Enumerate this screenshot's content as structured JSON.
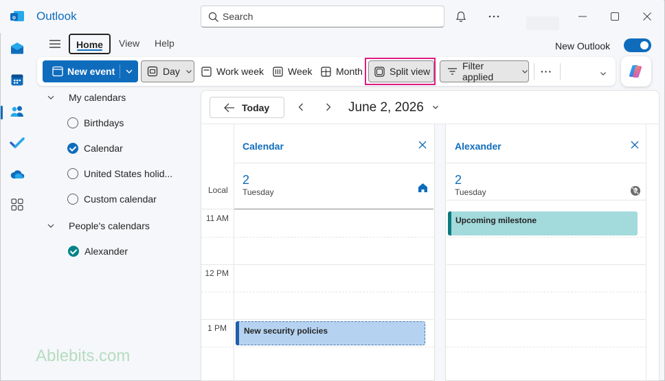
{
  "titlebar": {
    "app_name": "Outlook",
    "search_placeholder": "Search"
  },
  "menu": {
    "tabs": [
      "Home",
      "View",
      "Help"
    ],
    "new_outlook_label": "New Outlook",
    "new_outlook_enabled": true
  },
  "ribbon": {
    "new_event": "New event",
    "day": "Day",
    "work_week": "Work week",
    "week": "Week",
    "month": "Month",
    "split_view": "Split view",
    "filter": "Filter applied",
    "more": "···"
  },
  "folders": {
    "my_calendars": {
      "label": "My calendars",
      "items": [
        {
          "label": "Birthdays",
          "checked": false
        },
        {
          "label": "Calendar",
          "checked": true
        },
        {
          "label": "United States holid...",
          "checked": false
        },
        {
          "label": "Custom calendar",
          "checked": false
        }
      ]
    },
    "people_calendars": {
      "label": "People's calendars",
      "items": [
        {
          "label": "Alexander",
          "checked": true
        }
      ]
    }
  },
  "watermark": "Ablebits.com",
  "calendar": {
    "today_label": "Today",
    "date_title": "June 2, 2026",
    "local_label": "Local",
    "time_labels": [
      "11 AM",
      "12 PM",
      "1 PM"
    ],
    "columns": [
      {
        "name": "Calendar",
        "day_num": "2",
        "day_name": "Tuesday",
        "event": "New security policies"
      },
      {
        "name": "Alexander",
        "day_num": "2",
        "day_name": "Tuesday",
        "event": "Upcoming milestone"
      }
    ]
  },
  "colors": {
    "accent": "#0f6cbd",
    "highlight": "#e0197d",
    "event_calendar": "#b5d3f1",
    "event_alexander": "#a3dadc",
    "teal": "#038387"
  }
}
